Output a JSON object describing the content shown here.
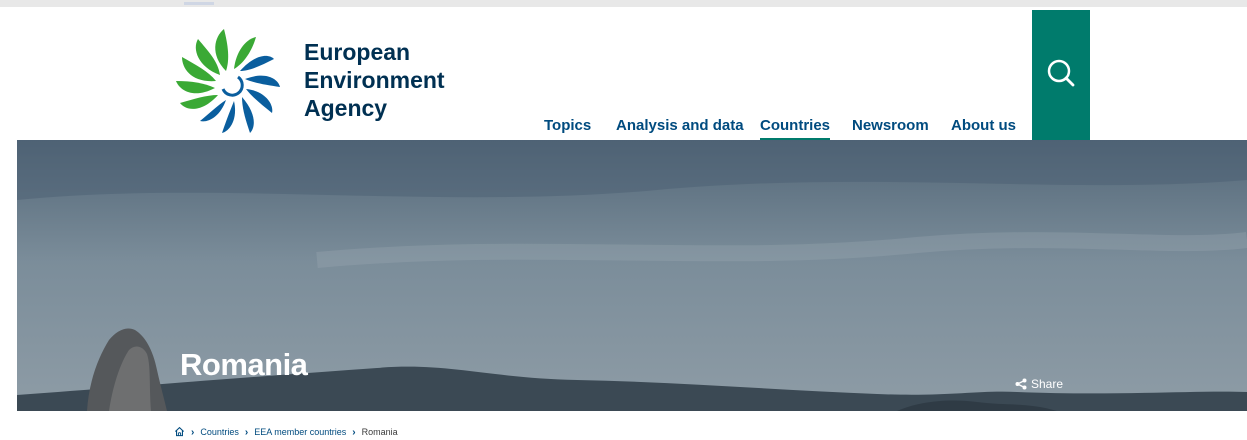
{
  "brand": {
    "lines": [
      "European",
      "Environment",
      "Agency"
    ]
  },
  "nav": {
    "items": [
      {
        "label": "Topics",
        "active": false
      },
      {
        "label": "Analysis and data",
        "active": false
      },
      {
        "label": "Countries",
        "active": true
      },
      {
        "label": "Newsroom",
        "active": false
      },
      {
        "label": "About us",
        "active": false
      }
    ]
  },
  "search": {
    "icon": "search-icon"
  },
  "hero": {
    "title": "Romania",
    "share_label": "Share",
    "share_icon": "share-icon"
  },
  "breadcrumb": {
    "home_icon": "home-icon",
    "items": [
      "Countries",
      "EEA member countries"
    ],
    "current": "Romania"
  },
  "colors": {
    "brand_green": "#007b6c",
    "nav_blue": "#004b7f",
    "logo_navy": "#003052"
  }
}
